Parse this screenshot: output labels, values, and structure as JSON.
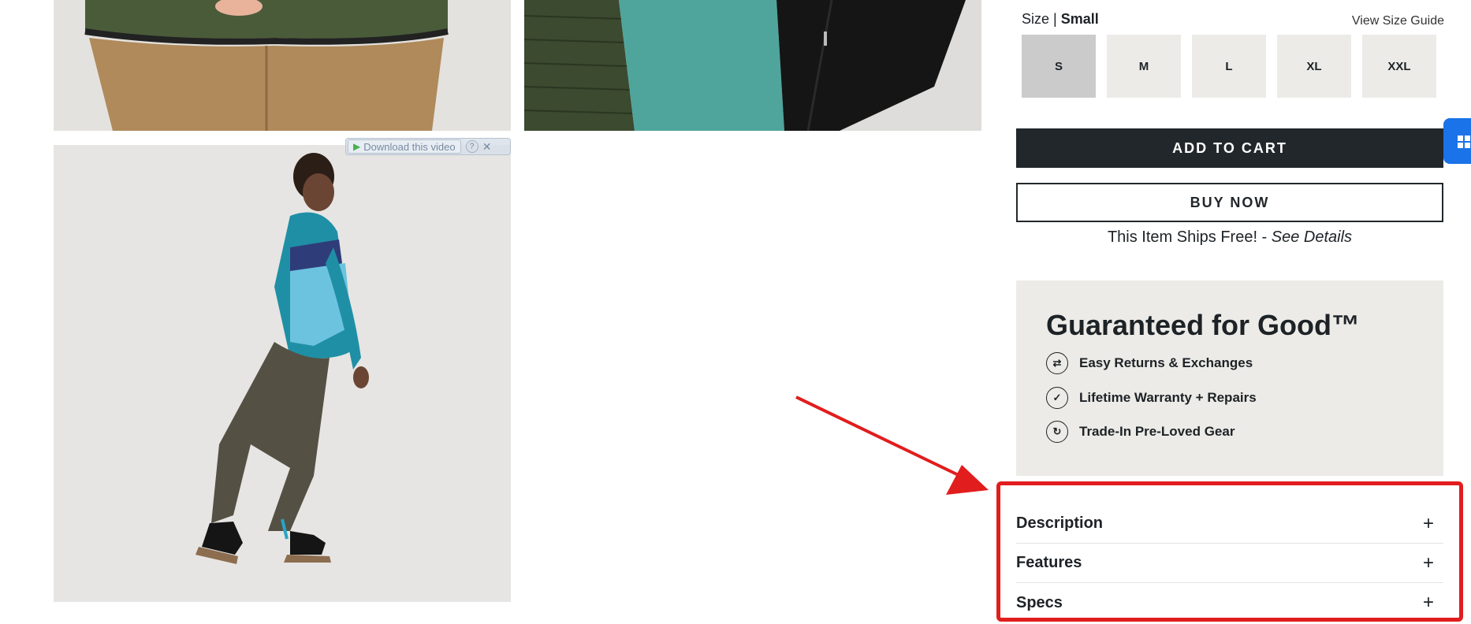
{
  "overlay": {
    "download_label": "Download this video",
    "help": "?",
    "close": "✕"
  },
  "size": {
    "label": "Size |",
    "selected": "Small",
    "guide_link": "View Size Guide",
    "options": [
      "S",
      "M",
      "L",
      "XL",
      "XXL"
    ],
    "selected_option": "S"
  },
  "actions": {
    "add_to_cart": "ADD TO CART",
    "buy_now": "BUY NOW"
  },
  "shipping": {
    "text": "This Item Ships Free! -",
    "link": "See Details"
  },
  "guarantee": {
    "title": "Guaranteed for Good™",
    "items": [
      {
        "label": "Easy Returns & Exchanges",
        "icon": "returns-icon"
      },
      {
        "label": "Lifetime Warranty + Repairs",
        "icon": "warranty-shield-icon"
      },
      {
        "label": "Trade-In Pre-Loved Gear",
        "icon": "recycle-icon"
      }
    ]
  },
  "accordion": [
    {
      "label": "Description",
      "toggle": "+"
    },
    {
      "label": "Features",
      "toggle": "+"
    },
    {
      "label": "Specs",
      "toggle": "+"
    }
  ],
  "colors": {
    "accent_dark": "#22272b",
    "annotation_red": "#e11d1d",
    "panel_bg": "#ecebe7",
    "side_tab": "#1a73e8"
  }
}
